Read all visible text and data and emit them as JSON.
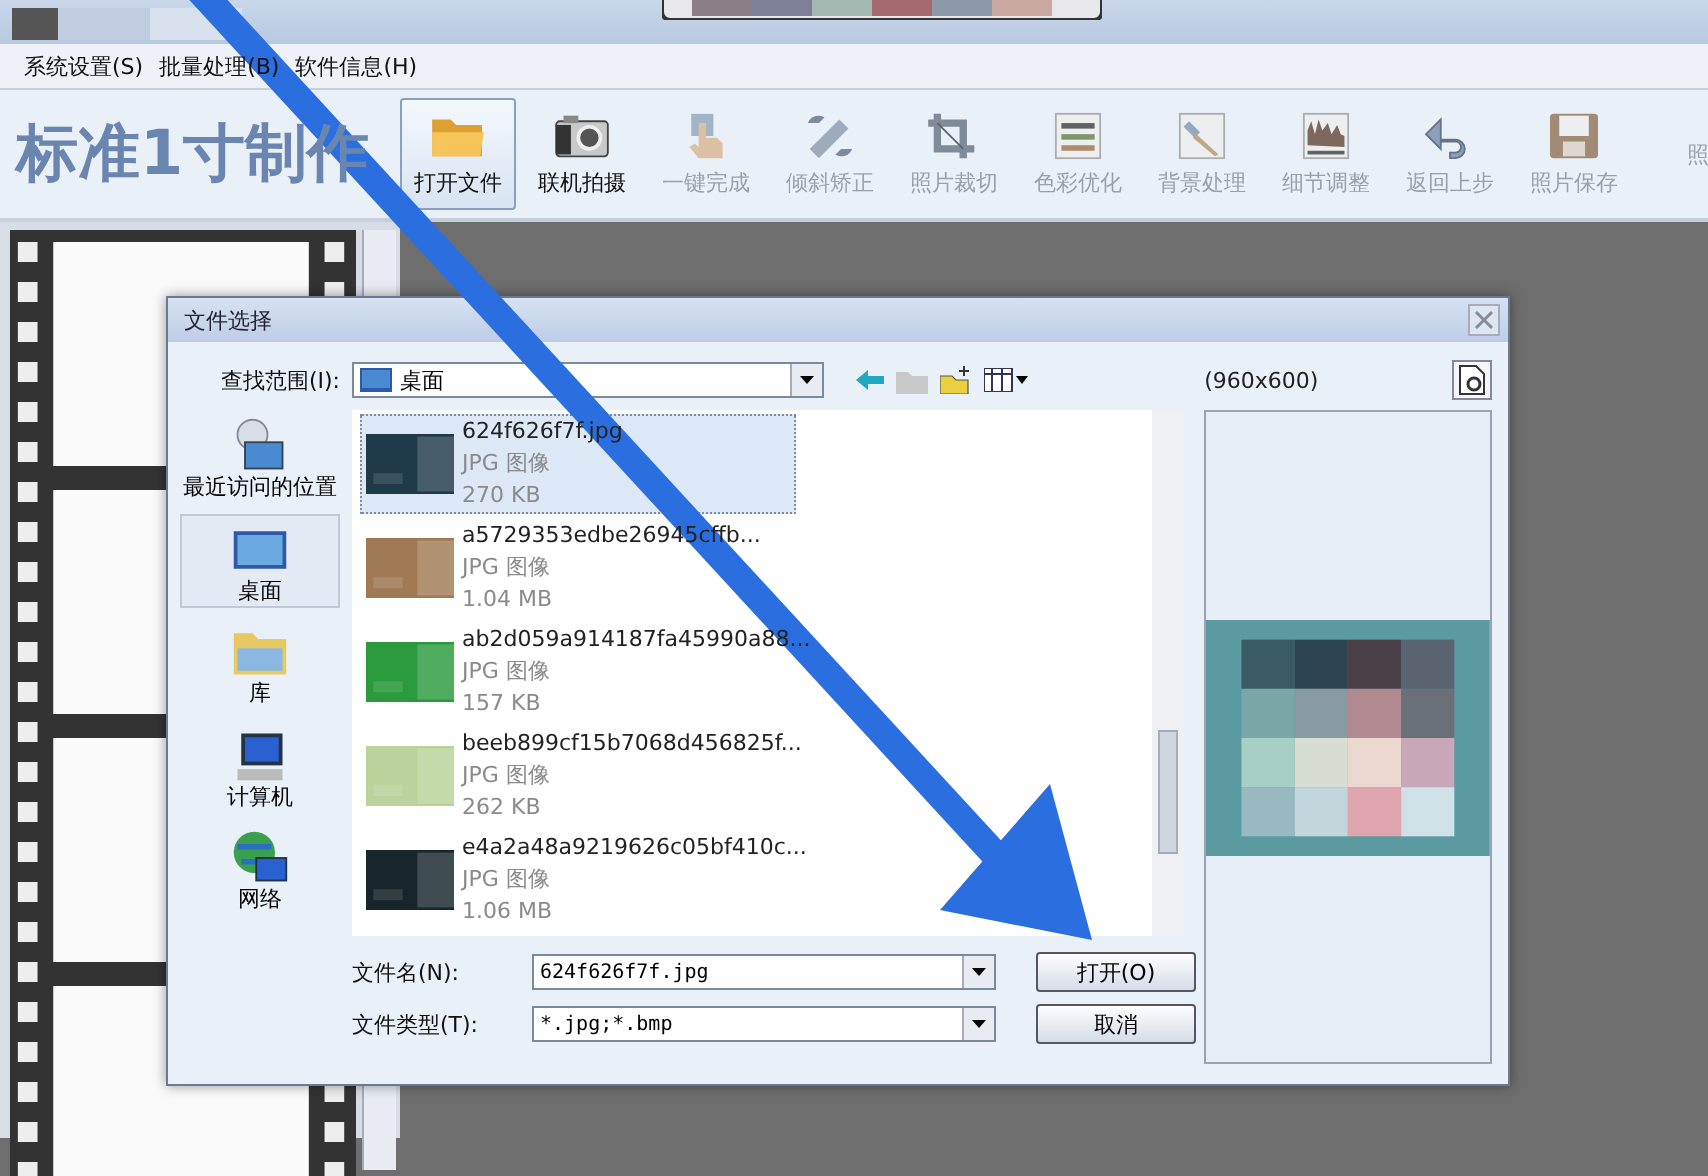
{
  "app": {
    "menu": [
      "系统设置(S)",
      "批量处理(B)",
      "软件信息(H)"
    ],
    "logo": "标准1寸制作",
    "tools": [
      {
        "label": "打开文件",
        "kind": "folder",
        "active": true,
        "disabled": false
      },
      {
        "label": "联机拍摄",
        "kind": "camera",
        "active": false,
        "disabled": false
      },
      {
        "label": "一键完成",
        "kind": "hand",
        "active": false,
        "disabled": true
      },
      {
        "label": "倾斜矫正",
        "kind": "tilt",
        "active": false,
        "disabled": true
      },
      {
        "label": "照片裁切",
        "kind": "crop",
        "active": false,
        "disabled": true
      },
      {
        "label": "色彩优化",
        "kind": "sliders",
        "active": false,
        "disabled": true
      },
      {
        "label": "背景处理",
        "kind": "brush",
        "active": false,
        "disabled": true
      },
      {
        "label": "细节调整",
        "kind": "histogram",
        "active": false,
        "disabled": true
      },
      {
        "label": "返回上步",
        "kind": "undo",
        "active": false,
        "disabled": true
      },
      {
        "label": "照片保存",
        "kind": "save",
        "active": false,
        "disabled": true
      },
      {
        "label": "照",
        "kind": "none",
        "active": false,
        "disabled": true
      }
    ]
  },
  "dialog": {
    "title": "文件选择",
    "look_in_label": "查找范围(I):",
    "look_in_value": "桌面",
    "places": [
      {
        "label": "最近访问的位置",
        "kind": "recent",
        "selected": false
      },
      {
        "label": "桌面",
        "kind": "desktop",
        "selected": true
      },
      {
        "label": "库",
        "kind": "library",
        "selected": false
      },
      {
        "label": "计算机",
        "kind": "computer",
        "selected": false
      },
      {
        "label": "网络",
        "kind": "network",
        "selected": false
      }
    ],
    "files": [
      {
        "name": "624f626f7f.jpg",
        "type": "JPG 图像",
        "size": "270 KB",
        "selected": true,
        "color": "#1f3a48"
      },
      {
        "name": "a5729353edbe26945cffb...",
        "type": "JPG 图像",
        "size": "1.04 MB",
        "selected": false,
        "color": "#a07a55"
      },
      {
        "name": "ab2d059a914187fa45990a88...",
        "type": "JPG 图像",
        "size": "157 KB",
        "selected": false,
        "color": "#2a9a3c"
      },
      {
        "name": "beeb899cf15b7068d456825f...",
        "type": "JPG 图像",
        "size": "262 KB",
        "selected": false,
        "color": "#b9d39a"
      },
      {
        "name": "e4a2a48a9219626c05bf410c...",
        "type": "JPG 图像",
        "size": "1.06 MB",
        "selected": false,
        "color": "#17262a"
      }
    ],
    "preview_size": "(960x600)",
    "file_name_label": "文件名(N):",
    "file_name": "624f626f7f.jpg",
    "file_type_label": "文件类型(T):",
    "file_type": "*.jpg;*.bmp",
    "buttons": [
      "打开(O)",
      "取消"
    ]
  }
}
